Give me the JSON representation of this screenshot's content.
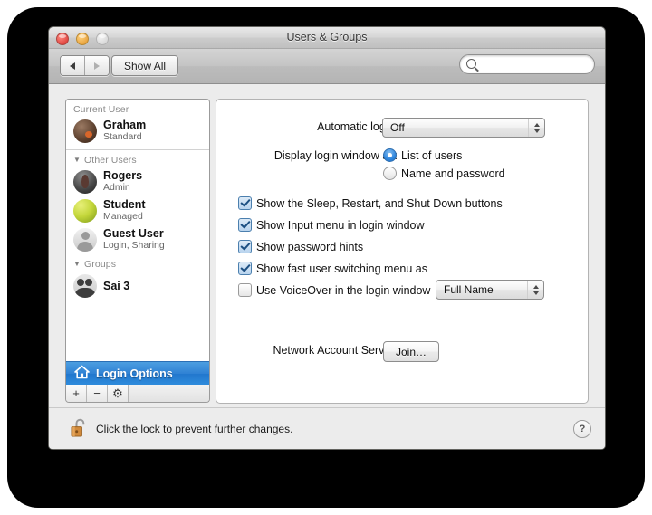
{
  "window": {
    "title": "Users & Groups",
    "traffic_lights": [
      "close-button",
      "minimize-button",
      "zoom-button"
    ]
  },
  "toolbar": {
    "back_label": "back-arrow",
    "forward_label": "forward-arrow",
    "show_all_label": "Show All",
    "search_placeholder": "",
    "search_value": ""
  },
  "sidebar": {
    "current_user_header": "Current User",
    "other_users_header": "Other Users",
    "groups_header": "Groups",
    "disclosure_glyph": "▼",
    "current_user": {
      "name": "Graham",
      "role": "Standard",
      "avatar": "graham-avatar"
    },
    "other_users": [
      {
        "name": "Rogers",
        "role": "Admin",
        "avatar": "rogers-avatar"
      },
      {
        "name": "Student",
        "role": "Managed",
        "avatar": "student-avatar"
      },
      {
        "name": "Guest User",
        "role": "Login, Sharing",
        "avatar": "guest-avatar"
      }
    ],
    "groups": [
      {
        "name": "Sai 3",
        "avatar": "group-avatar"
      }
    ],
    "login_options_label": "Login Options",
    "buttons": {
      "add": "+",
      "remove": "−",
      "settings": "⚙"
    }
  },
  "main": {
    "automatic_login_label": "Automatic login:",
    "automatic_login_value": "Off",
    "display_login_window_label": "Display login window as:",
    "radios": [
      {
        "label": "List of users",
        "selected": true
      },
      {
        "label": "Name and password",
        "selected": false
      }
    ],
    "checkboxes": [
      {
        "label": "Show the Sleep, Restart, and Shut Down buttons",
        "checked": true
      },
      {
        "label": "Show Input menu in login window",
        "checked": true
      },
      {
        "label": "Show password hints",
        "checked": true
      },
      {
        "label": "Show fast user switching menu as",
        "checked": true
      },
      {
        "label": "Use VoiceOver in the login window",
        "checked": false
      }
    ],
    "fast_user_switching_value": "Full Name",
    "network_account_server_label": "Network Account Server:",
    "join_button_label": "Join…"
  },
  "footer": {
    "lock_text": "Click the lock to prevent further changes.",
    "lock_state": "unlocked",
    "help_label": "?"
  },
  "colors": {
    "selection_blue": "#2f81d4",
    "window_bg": "#ececec",
    "panel_bg": "#ffffff",
    "lock_body": "#d08a3c"
  }
}
